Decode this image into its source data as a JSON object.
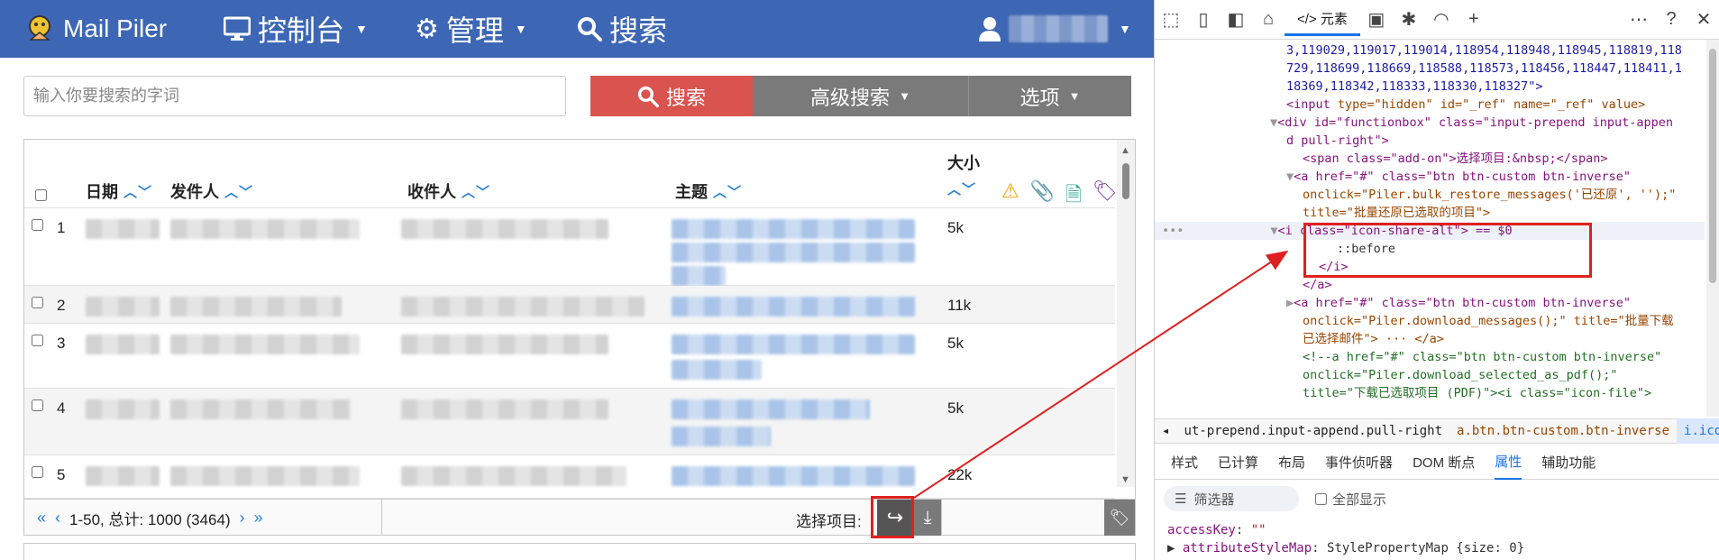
{
  "navbar": {
    "brand": "Mail Piler",
    "dashboard": "控制台",
    "admin": "管理",
    "search": "搜索"
  },
  "search": {
    "placeholder": "输入你要搜索的字词",
    "button": "搜索",
    "advanced": "高级搜索",
    "options": "选项"
  },
  "table": {
    "headers": {
      "date": "日期",
      "sender": "发件人",
      "recipient": "收件人",
      "subject": "主题",
      "size": "大小"
    },
    "rows": [
      {
        "num": "1",
        "size": "5k"
      },
      {
        "num": "2",
        "size": "11k"
      },
      {
        "num": "3",
        "size": "5k"
      },
      {
        "num": "4",
        "size": "5k"
      },
      {
        "num": "5",
        "size": "22k"
      }
    ]
  },
  "footer": {
    "range": "1-50, 总计: 1000 (3464)",
    "select_label": "选择项目:"
  },
  "devtools": {
    "elements_tab": "元素",
    "dom_lines": {
      "l1": "3,119029,119017,119014,118954,118948,118945,118819,118",
      "l2": "729,118699,118669,118588,118573,118456,118447,118411,1",
      "l3": "18369,118342,118333,118330,118327\">",
      "l4_tag": "<input",
      "l4_attrs": " type=\"hidden\" id=\"_ref\" name=\"_ref\" value>",
      "l5": "<div id=\"functionbox\" class=\"input-prepend input-appen",
      "l6": "d pull-right\">",
      "l7": "<span class=\"add-on\">选择项目:&nbsp;</span>",
      "l8": "<a href=\"#\" class=\"btn btn-custom btn-inverse\"",
      "l9": "onclick=\"Piler.bulk_restore_messages('已还原', '');\"",
      "l10": "title=\"批量还原已选取的项目\">",
      "l11": "<i class=\"icon-share-alt\"> == $0",
      "l12": "::before",
      "l13": "</i>",
      "l14": "</a>",
      "l15": "<a href=\"#\" class=\"btn btn-custom btn-inverse\"",
      "l16": "onclick=\"Piler.download_messages();\" title=\"批量下载",
      "l17": "已选择邮件\"> ··· </a>",
      "l18": "<!--a href=\"#\" class=\"btn btn-custom btn-inverse\"",
      "l19": "onclick=\"Piler.download_selected_as_pdf();\"",
      "l20": "title=\"下载已选取项目 (PDF)\"><i class=\"icon-file\">"
    },
    "crumbs": {
      "c1": "ut-prepend.input-append.pull-right",
      "c2": "a.btn.btn-custom.btn-inverse",
      "c3": "i.icon-share-alt"
    },
    "sub_tabs": {
      "styles": "样式",
      "computed": "已计算",
      "layout": "布局",
      "listeners": "事件侦听器",
      "dom_breakpoints": "DOM 断点",
      "properties": "属性",
      "accessibility": "辅助功能"
    },
    "filter_placeholder": "筛选器",
    "show_all": "全部显示",
    "props": {
      "p1_key": "accessKey",
      "p1_val": "\"\"",
      "p2_key": "attributeStyleMap",
      "p2_val": "StylePropertyMap {size: 0}"
    }
  },
  "colors": {
    "navbar": "#3d67b5",
    "search_button": "#d9534f",
    "sort_arrows": "#2a7fd4",
    "highlight": "#e02020"
  }
}
